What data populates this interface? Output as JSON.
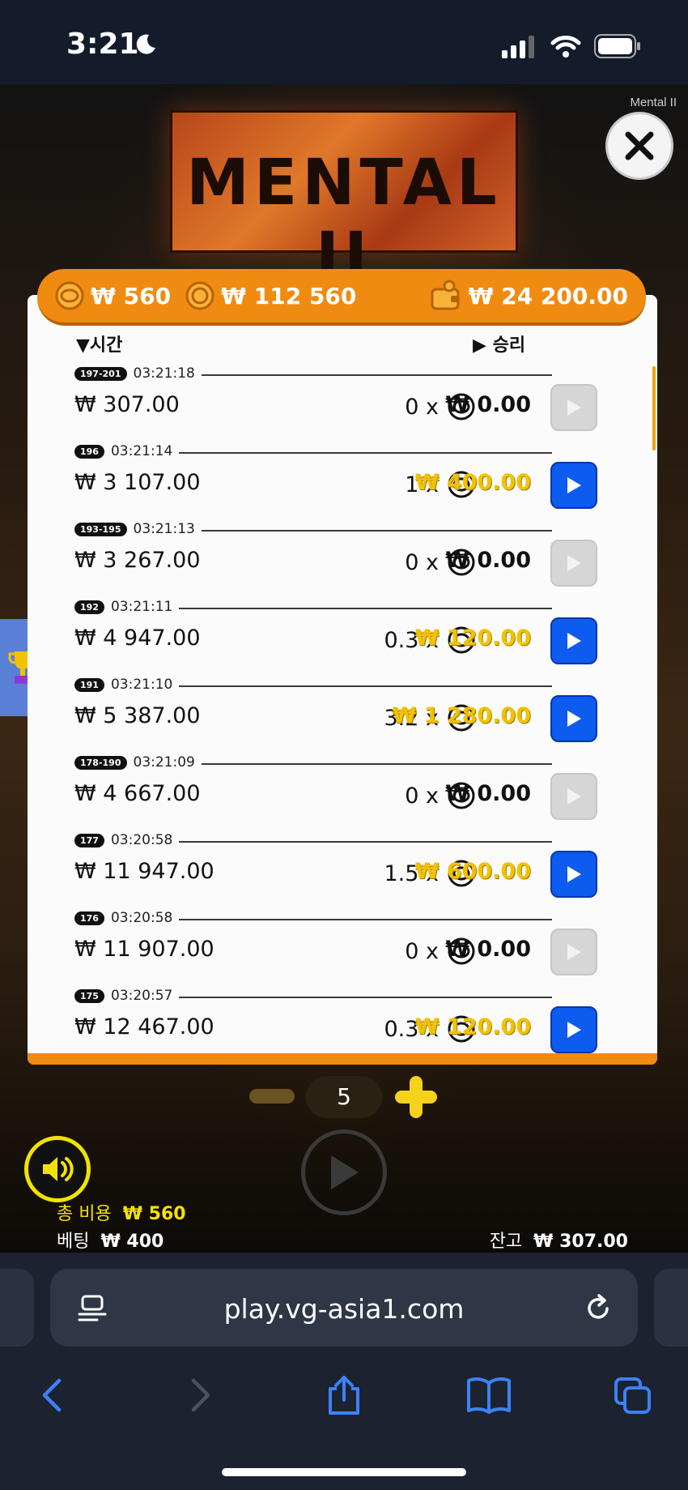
{
  "status": {
    "time": "3:21"
  },
  "game": {
    "title_small": "Mental II",
    "logo_text": "MENTAL II"
  },
  "balances": {
    "left": "₩ 560",
    "middle": "₩ 112 560",
    "right": "₩ 24 200.00"
  },
  "history": {
    "header_time": "시간",
    "header_win": "승리",
    "rows": [
      {
        "badge": "197-201",
        "time": "03:21:18",
        "bet": "₩ 307.00",
        "mult": "0 x",
        "win": "₩ 0.00",
        "replay": false
      },
      {
        "badge": "196",
        "time": "03:21:14",
        "bet": "₩ 3 107.00",
        "mult": "1 x",
        "win": "₩ 400.00",
        "replay": true
      },
      {
        "badge": "193-195",
        "time": "03:21:13",
        "bet": "₩ 3 267.00",
        "mult": "0 x",
        "win": "₩ 0.00",
        "replay": false
      },
      {
        "badge": "192",
        "time": "03:21:11",
        "bet": "₩ 4 947.00",
        "mult": "0.3 x",
        "win": "₩ 120.00",
        "replay": true
      },
      {
        "badge": "191",
        "time": "03:21:10",
        "bet": "₩ 5 387.00",
        "mult": "3.2 x",
        "win": "₩ 1 280.00",
        "replay": true
      },
      {
        "badge": "178-190",
        "time": "03:21:09",
        "bet": "₩ 4 667.00",
        "mult": "0 x",
        "win": "₩ 0.00",
        "replay": false
      },
      {
        "badge": "177",
        "time": "03:20:58",
        "bet": "₩ 11 947.00",
        "mult": "1.5 x",
        "win": "₩ 600.00",
        "replay": true
      },
      {
        "badge": "176",
        "time": "03:20:58",
        "bet": "₩ 11 907.00",
        "mult": "0 x",
        "win": "₩ 0.00",
        "replay": false
      },
      {
        "badge": "175",
        "time": "03:20:57",
        "bet": "₩ 12 467.00",
        "mult": "0.3 x",
        "win": "₩ 120.00",
        "replay": true
      }
    ]
  },
  "controls": {
    "quantity": "5",
    "total_cost_label": "총 비용",
    "total_cost_value": "₩ 560",
    "bet_label": "베팅",
    "bet_value": "₩ 400",
    "balance_label": "잔고",
    "balance_value": "₩ 307.00"
  },
  "browser": {
    "url": "play.vg-asia1.com"
  },
  "colors": {
    "accent_orange": "#f08b12",
    "win_gold": "#f2c200",
    "replay_blue": "#0e5bf0",
    "sound_yellow": "#f2e200"
  }
}
